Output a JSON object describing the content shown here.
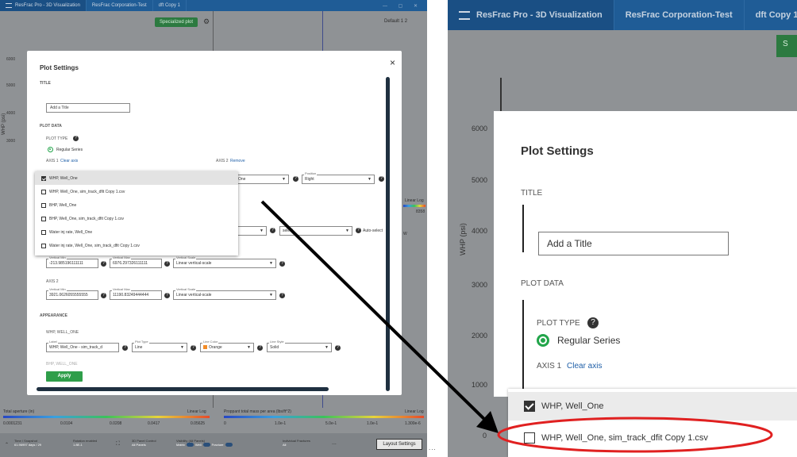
{
  "app": {
    "tabs": [
      "ResFrac Pro - 3D Visualization",
      "ResFrac Corporation-Test",
      "dft Copy 1"
    ],
    "zoomed_tabs": [
      "ResFrac Pro - 3D Visualization",
      "ResFrac Corporation-Test",
      "dft Copy 1"
    ],
    "window_controls": "— ▢ ✕"
  },
  "toolbar": {
    "specialized_plot": "Specialized plot",
    "default_selector": "Default",
    "tick_1": "1",
    "tick_2": "2"
  },
  "background_plot": {
    "y_axis_label": "WHP (psi)",
    "y_ticks": [
      "6000",
      "5000",
      "4000",
      "3000",
      "2000",
      "1000",
      "0"
    ],
    "right_linear": "Linear",
    "right_log": "Log",
    "right_value": "8358",
    "legend_short": "W"
  },
  "modal": {
    "title": "Plot Settings",
    "close": "×",
    "title_section": "TITLE",
    "title_placeholder": "Add a Title",
    "plot_data_section": "PLOT DATA",
    "plot_type_label": "PLOT TYPE",
    "plot_type_value": "Regular Series",
    "axis1_label": "AXIS 1",
    "axis1_clear": "Clear axis",
    "axis2_label": "AXIS 2",
    "axis2_remove": "Remove",
    "series_partial": "One",
    "position_label": "Position",
    "position_value": "Right",
    "select_partial": "select",
    "auto_select": "Auto-select",
    "vertical_min_label": "Vertical Min",
    "vertical_max_label": "Vertical Max",
    "vertical_scale_label": "Vertical Scale",
    "axis1_vmin": "-213.985196111111",
    "axis1_vmax": "6976.297326111111",
    "axis1_scale": "Linear vertical-scale",
    "axis2_title": "AXIS 2",
    "axis2_vmin": "3921.0626055555555",
    "axis2_vmax": "11190.83249444444",
    "axis2_scale": "Linear vertical-scale",
    "appearance_section": "APPEARANCE",
    "series_heading": "WHP, WELL_ONE",
    "label_label": "Label",
    "label_value": "WHP, Well_One - sim_track_d",
    "plot_type_field_label": "Plot Type",
    "plot_type_field": "Line",
    "line_color_label": "Line Color",
    "line_color_value": "Orange",
    "line_style_label": "Line Style",
    "line_style_value": "Solid",
    "next_series_partial": "BHP, WELL_ONE",
    "apply": "Apply"
  },
  "dropdown": {
    "items": [
      {
        "label": "WHP, Well_One",
        "checked": true
      },
      {
        "label": "WHP, Well_One, sim_track_dfit Copy 1.csv",
        "checked": false
      },
      {
        "label": "BHP, Well_One",
        "checked": false
      },
      {
        "label": "BHP, Well_One, sim_track_dfit Copy 1.csv",
        "checked": false
      },
      {
        "label": "Water inj rate, Well_One",
        "checked": false
      },
      {
        "label": "Water inj rate, Well_One, sim_track_dfit Copy 1.csv",
        "checked": false
      }
    ]
  },
  "colorbars": {
    "left_title": "Total aperture (in)",
    "left_min": "0.0001231",
    "left_ticks": [
      "0.0104",
      "0.0208",
      "0.0417",
      "0.05625"
    ],
    "right_title": "Proppant total mass per area (lbs/ft^2)",
    "right_min": "0",
    "right_ticks": [
      "1.0e-1",
      "5.0e-1",
      "1.0e-1",
      "1.300e-6"
    ],
    "linear": "Linear",
    "log": "Log"
  },
  "bottombar": {
    "time_label": "Time / Snapshot",
    "time_value": "61.96997 days / 29",
    "rotation_label": "Rotation enabled",
    "rotation_value": "1.8E-1",
    "panel_label": "3D Panel Control",
    "panel_value": "All Panels",
    "visibility_label": "Visibility (All Panels)",
    "matrix": "Matrix",
    "well": "Well",
    "fracture": "Fracture",
    "individual_label": "Individual Fractures",
    "individual_value": "All",
    "more": "...",
    "layout_settings": "Layout Settings"
  },
  "zoom": {
    "green_button_partial": "S",
    "y_axis_label": "WHP (psi)",
    "y_ticks": [
      "6000",
      "5000",
      "4000",
      "3000",
      "2000",
      "1000",
      "0"
    ],
    "modal_title": "Plot Settings",
    "title_section": "TITLE",
    "title_placeholder": "Add a Title",
    "plot_data_section": "PLOT DATA",
    "plot_type_label": "PLOT TYPE",
    "plot_type_value": "Regular Series",
    "axis1_label": "AXIS 1",
    "axis1_clear": "Clear axis",
    "item1": "WHP, Well_One",
    "item2": "WHP, Well_One, sim_track_dfit Copy 1.csv"
  },
  "colors": {
    "titlebar": "#1f5c96",
    "accent_green": "#2f9e4a",
    "annotation_red": "#e02020",
    "arrow": "#000000"
  },
  "ellipsis": "..."
}
